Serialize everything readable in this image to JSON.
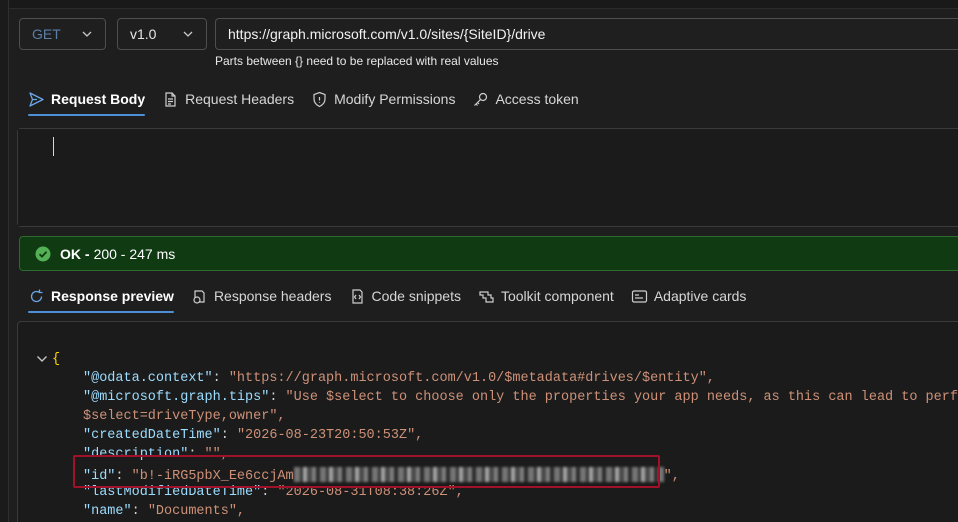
{
  "request": {
    "method": "GET",
    "version": "v1.0",
    "url": "https://graph.microsoft.com/v1.0/sites/{SiteID}/drive",
    "url_hint": "Parts between {} need to be replaced with real values",
    "tabs": [
      {
        "label": "Request Body",
        "icon": "send-icon",
        "active": true
      },
      {
        "label": "Request Headers",
        "icon": "document-icon",
        "active": false
      },
      {
        "label": "Modify Permissions",
        "icon": "shield-icon",
        "active": false
      },
      {
        "label": "Access token",
        "icon": "key-icon",
        "active": false
      }
    ]
  },
  "status": {
    "ok_label": "OK -",
    "detail": "200 - 247 ms",
    "color": "#0f3a12"
  },
  "response": {
    "tabs": [
      {
        "label": "Response preview",
        "icon": "refresh-icon",
        "active": true
      },
      {
        "label": "Response headers",
        "icon": "headers-icon",
        "active": false
      },
      {
        "label": "Code snippets",
        "icon": "code-snippet-icon",
        "active": false
      },
      {
        "label": "Toolkit component",
        "icon": "toolkit-icon",
        "active": false
      },
      {
        "label": "Adaptive cards",
        "icon": "card-icon",
        "active": false
      }
    ],
    "json": {
      "open_brace": "{",
      "lines": [
        {
          "key": "\"@odata.context\"",
          "value": "\"https://graph.microsoft.com/v1.0/$metadata#drives/$entity\","
        },
        {
          "key": "\"@microsoft.graph.tips\"",
          "value": "\"Use $select to choose only the properties your app needs, as this can lead to performance improvements. For example: GET sites('<key>')/drive?"
        },
        {
          "key": "",
          "value": "$select=driveType,owner\","
        },
        {
          "key": "\"createdDateTime\"",
          "value": "\"2026-08-23T20:50:53Z\","
        },
        {
          "key": "\"description\"",
          "value": "\"\","
        },
        {
          "key": "\"id\"",
          "value": "\"b!-iRG5pbX_Ee6ccjAm",
          "redacted": true,
          "tail": "\","
        },
        {
          "key": "\"lastModifiedDateTime\"",
          "value": "\"2026-08-31T08:38:26Z\","
        },
        {
          "key": "\"name\"",
          "value": "\"Documents\","
        }
      ]
    }
  }
}
